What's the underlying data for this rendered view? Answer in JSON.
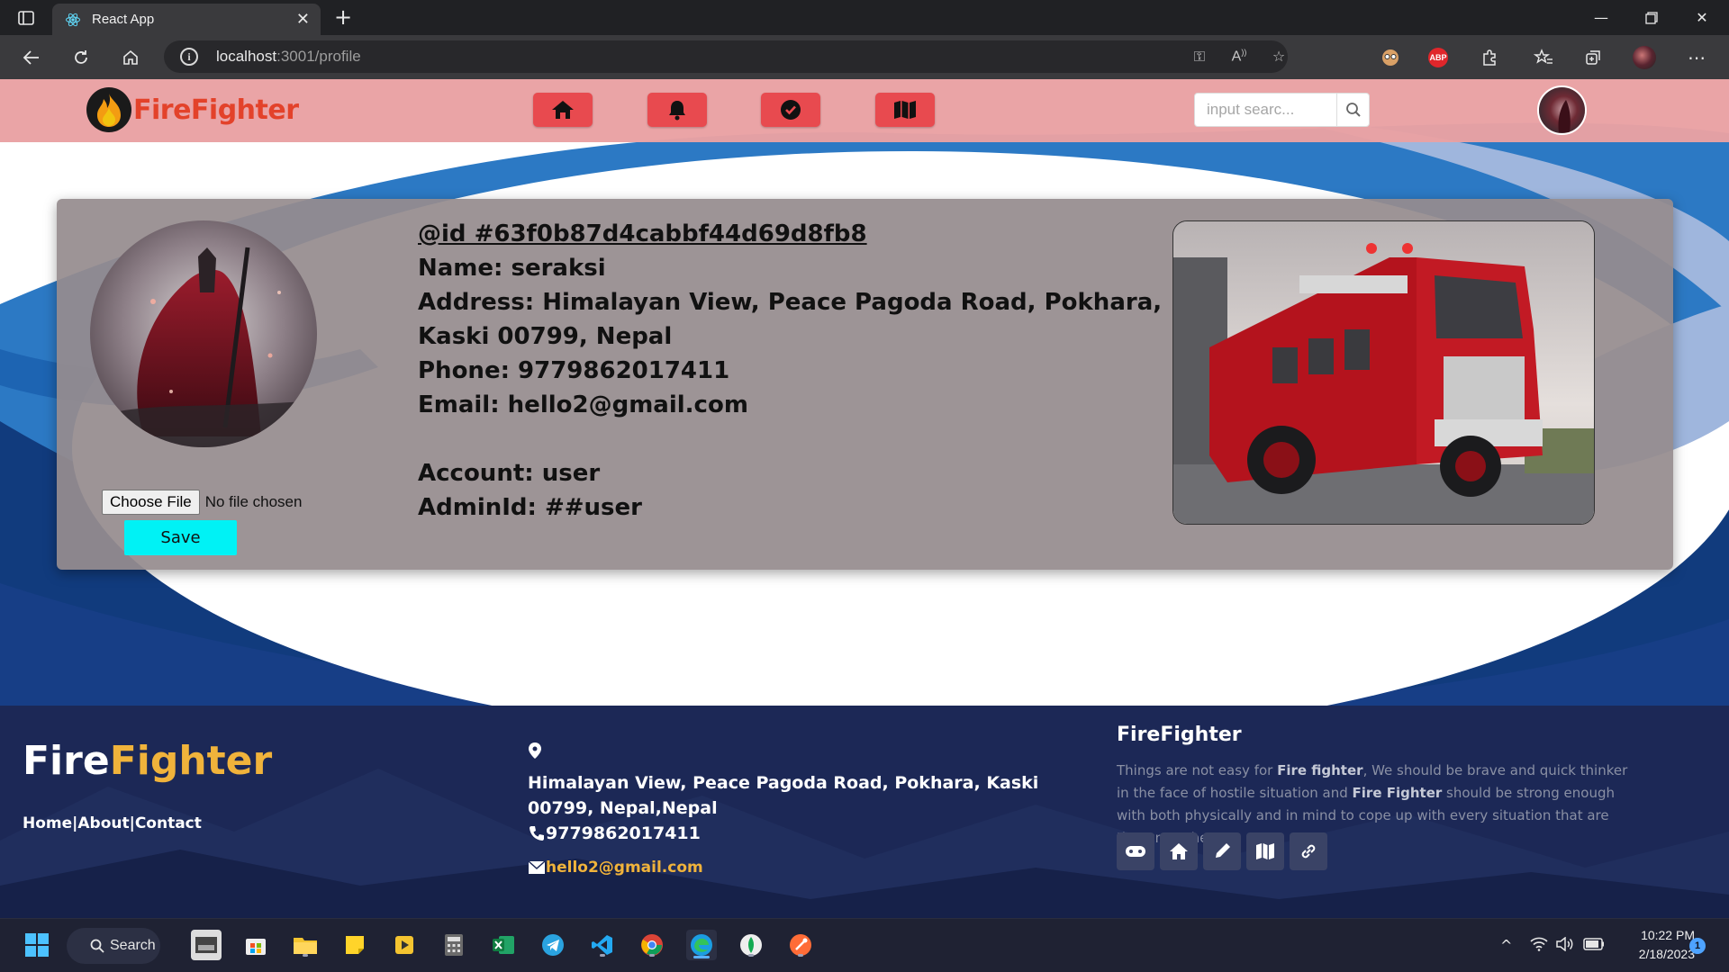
{
  "browser": {
    "tab_title": "React App",
    "url_host": "localhost",
    "url_rest": ":3001/profile"
  },
  "app": {
    "logo_text": "FireFighter",
    "nav": [
      "home",
      "notifications",
      "check",
      "map"
    ],
    "search_placeholder": "input searc..."
  },
  "profile": {
    "id_line": "@id #63f0b87d4cabbf44d69d8fb8",
    "name_line": "Name: seraksi",
    "address_line": "Address: Himalayan View, Peace Pagoda Road, Pokhara, Kaski 00799, Nepal",
    "phone_line": "Phone: 9779862017411",
    "email_line": "Email: hello2@gmail.com",
    "account_line": "Account: user",
    "adminid_line": "AdminId: ##user",
    "choose_file_label": "Choose File",
    "file_status": "No file chosen",
    "save_label": "Save"
  },
  "footer": {
    "brand_fire": "Fire",
    "brand_fighter": "Fighter",
    "link_home": "Home",
    "link_about": "About",
    "link_contact": "Contact",
    "sep": "|",
    "address": "Himalayan View, Peace Pagoda Road, Pokhara, Kaski 00799, Nepal,Nepal",
    "phone": "9779862017411",
    "email": "hello2@gmail.com",
    "title": "FireFighter",
    "desc_1": "Things are not easy for ",
    "desc_b1": "Fire fighter",
    "desc_2": ", We should be brave and quick thinker in the face of hostile situation and ",
    "desc_b2": "Fire Fighter",
    "desc_3": " should be strong enough with both physically and in mind to cope up with every situation that are thrown at them."
  },
  "taskbar": {
    "search_label": "Search",
    "time": "10:22 PM",
    "date": "2/18/2023",
    "notification_count": "1"
  },
  "colors": {
    "header": "#e9a1a3",
    "nav_button": "#e84a4f",
    "save_button": "#00f2f5",
    "footer": "#1c2856",
    "accent_yellow": "#f0b33b"
  }
}
